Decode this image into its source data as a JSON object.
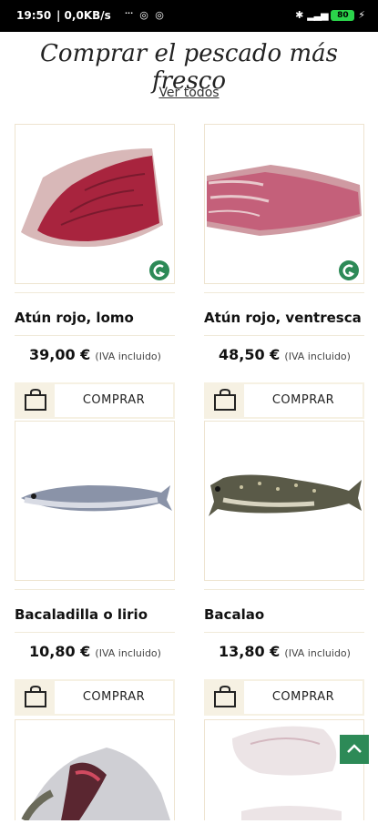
{
  "status": {
    "time": "19:50",
    "net": "| 0,0KB/s",
    "dots": "···",
    "battery": "80"
  },
  "title": "Comprar el pescado más fresco",
  "view_all": "Ver todos",
  "buy_label": "COMPRAR",
  "vat_label": "(IVA incluido)",
  "products": [
    {
      "name": "Atún rojo, lomo",
      "price": "39,00 €"
    },
    {
      "name": "Atún rojo, ventresca",
      "price": "48,50 €"
    },
    {
      "name": "Bacaladilla o lirio",
      "price": "10,80 €"
    },
    {
      "name": "Bacalao",
      "price": "13,80 €"
    }
  ],
  "icons": {
    "bag": "shopping-bag-icon",
    "brand": "brand-logo-icon",
    "scroll": "chevron-up-icon"
  },
  "colors": {
    "accent_green": "#2d8a57",
    "card_beige": "#f6f1e3"
  }
}
